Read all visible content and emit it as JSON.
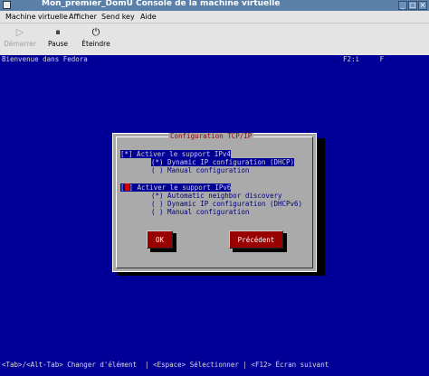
{
  "window": {
    "title": "Mon_premier_DomU Console de la machine virtuelle",
    "buttons": {
      "minimize": "_",
      "maximize": "□",
      "close": "×"
    }
  },
  "menu": [
    "Machine virtuelle",
    "Afficher",
    "Send key",
    "Aide"
  ],
  "toolbar": [
    {
      "label": "Démarrer",
      "icon": "play-icon",
      "enabled": false
    },
    {
      "label": "Pause",
      "icon": "pause-icon",
      "enabled": true
    },
    {
      "label": "Éteindre",
      "icon": "power-icon",
      "enabled": true
    }
  ],
  "console": {
    "welcome": "Bienvenue dans Fedora",
    "hints": "F2:i     F",
    "dialog": {
      "title": "Configuration TCP/IP",
      "ipv4_check": "[*] Activer le support IPv4",
      "ipv4_dhcp": "(*) Dynamic IP configuration (DHCP)",
      "ipv4_manual": "( ) Manual configuration",
      "ipv6_check_bracket": "[",
      "ipv6_check_rest": "] Activer le support IPv6",
      "ipv6_auto": "(*) Automatic neighbor discovery",
      "ipv6_dhcp": "( ) Dynamic IP configuration (DHCPv6)",
      "ipv6_manual": "( ) Manual configuration",
      "ok_button": "OK",
      "back_button": "Précédent"
    },
    "status": "<Tab>/<Alt-Tab> Changer d'élément  | <Espace> Sélectionner | <F12> Écran suivant"
  }
}
